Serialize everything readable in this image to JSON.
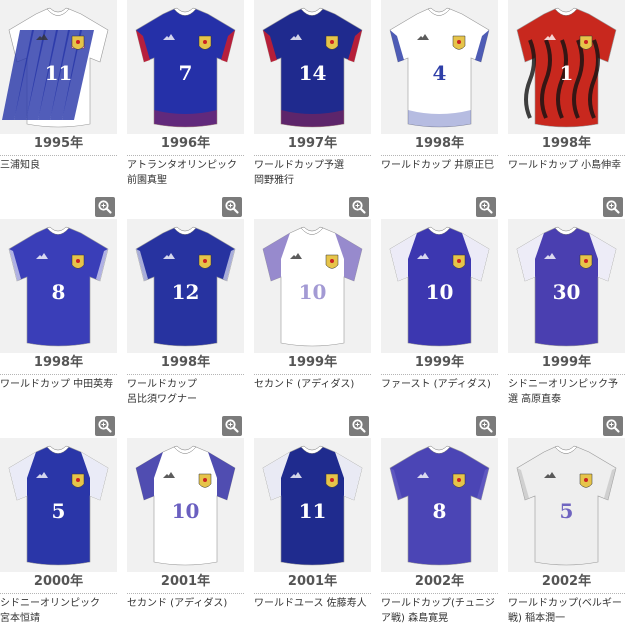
{
  "icons": {
    "zoom": "magnifier-zoom-icon",
    "jersey": "jersey-image"
  },
  "colors": {
    "tile_bg": "#f1f1f1",
    "zoom_bg": "#7b7b7b",
    "year_text": "#555555",
    "desc_text": "#333333"
  },
  "jerseys": [
    {
      "year": "1995年",
      "description": "三浦知良",
      "number": "11",
      "shirt": "#ffffff",
      "accent": "#2535a8",
      "numcolor": "#ffffff",
      "style": "pattern"
    },
    {
      "year": "1996年",
      "description": "アトランタオリンピック\n前園真聖",
      "number": "7",
      "shirt": "#2530a8",
      "accent": "#d01c2a",
      "numcolor": "#ffffff",
      "style": "flame"
    },
    {
      "year": "1997年",
      "description": "ワールドカップ予選\n岡野雅行",
      "number": "14",
      "shirt": "#1f2a8e",
      "accent": "#d01c2a",
      "numcolor": "#ffffff",
      "style": "flame"
    },
    {
      "year": "1998年",
      "description": "ワールドカップ 井原正巳",
      "number": "4",
      "shirt": "#ffffff",
      "accent": "#2f3fa8",
      "numcolor": "#2f3fa8",
      "style": "flame"
    },
    {
      "year": "1998年",
      "description": "ワールドカップ 小島伸幸",
      "number": "1",
      "shirt": "#c8281e",
      "accent": "#111111",
      "numcolor": "#ffffff",
      "style": "keeper"
    },
    {
      "year": "1998年",
      "description": "ワールドカップ 中田英寿",
      "number": "8",
      "shirt": "#3a3eb8",
      "accent": "#ffffff",
      "numcolor": "#ffffff",
      "style": "plain"
    },
    {
      "year": "1998年",
      "description": "ワールドカップ\n呂比須ワグナー",
      "number": "12",
      "shirt": "#2733a0",
      "accent": "#ffffff",
      "numcolor": "#ffffff",
      "style": "plain"
    },
    {
      "year": "1999年",
      "description": "セカンド (アディダス)",
      "number": "10",
      "shirt": "#ffffff",
      "accent": "#8c7dc8",
      "numcolor": "#a39ad4",
      "style": "sleeves"
    },
    {
      "year": "1999年",
      "description": "ファースト (アディダス)",
      "number": "10",
      "shirt": "#3c37b0",
      "accent": "#ffffff",
      "numcolor": "#ffffff",
      "style": "sleeves"
    },
    {
      "year": "1999年",
      "description": "シドニーオリンピック予選 高原直泰",
      "number": "30",
      "shirt": "#4a3fb0",
      "accent": "#ffffff",
      "numcolor": "#ffffff",
      "style": "sleeves"
    },
    {
      "year": "2000年",
      "description": "シドニーオリンピック\n宮本恒靖",
      "number": "5",
      "shirt": "#2a36a8",
      "accent": "#ffffff",
      "numcolor": "#ffffff",
      "style": "sleeves"
    },
    {
      "year": "2001年",
      "description": "セカンド (アディダス)",
      "number": "10",
      "shirt": "#ffffff",
      "accent": "#3d3aa8",
      "numcolor": "#6a5fc0",
      "style": "sleeves"
    },
    {
      "year": "2001年",
      "description": "ワールドユース 佐藤寿人",
      "number": "11",
      "shirt": "#1f2b8e",
      "accent": "#ffffff",
      "numcolor": "#ffffff",
      "style": "sleeves"
    },
    {
      "year": "2002年",
      "description": "ワールドカップ(チュニジア戦) 森島寛晃",
      "number": "8",
      "shirt": "#4b45b5",
      "accent": "#6a64c8",
      "numcolor": "#ffffff",
      "style": "plain"
    },
    {
      "year": "2002年",
      "description": "ワールドカップ(ベルギー戦) 稲本潤一",
      "number": "5",
      "shirt": "#eeeeee",
      "accent": "#bdbdbd",
      "numcolor": "#6f64c0",
      "style": "plain"
    }
  ]
}
